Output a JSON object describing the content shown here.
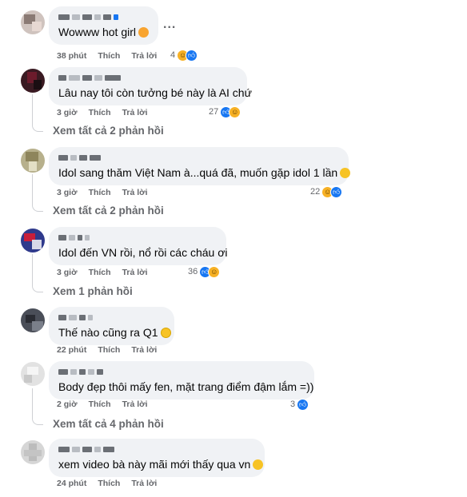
{
  "actions": {
    "like": "Thích",
    "reply": "Trả lời",
    "more": "..."
  },
  "comments": [
    {
      "text": "Wowww hot girl",
      "emoji": "smiling-face-with-hearts",
      "time": "38 phút",
      "reaction_count": "4",
      "reactions": [
        "haha",
        "like"
      ]
    },
    {
      "text": "Lâu nay tôi còn tưởng bé này là AI chứ",
      "time": "3 giờ",
      "reaction_count": "27",
      "reactions": [
        "like",
        "haha"
      ],
      "view_replies": "Xem tất cả 2 phản hồi"
    },
    {
      "text": "Idol sang thăm Việt Nam à...quá đã, muốn gặp idol 1 lần",
      "emoji": "rolling-on-floor-laughing",
      "time": "3 giờ",
      "reaction_count": "22",
      "reactions": [
        "haha",
        "like"
      ],
      "view_replies": "Xem tất cả 2 phản hồi"
    },
    {
      "text": "Idol đến VN rồi, nổ rồi các cháu ơi",
      "time": "3 giờ",
      "reaction_count": "36",
      "reactions": [
        "like",
        "haha"
      ],
      "view_replies": "Xem 1 phản hồi"
    },
    {
      "text": "Thế nào cũng ra Q1",
      "emoji": "grinning-face",
      "time": "22 phút"
    },
    {
      "text": "Body đẹp thôi mấy fen, mặt trang điểm đậm lắm =))",
      "time": "2 giờ",
      "reaction_count": "3",
      "reactions": [
        "like"
      ],
      "view_replies": "Xem tất cả 4 phản hồi"
    },
    {
      "text": "xem video bà này mãi mới thấy qua vn",
      "emoji": "rolling-on-floor-laughing",
      "time": "24 phút"
    }
  ]
}
